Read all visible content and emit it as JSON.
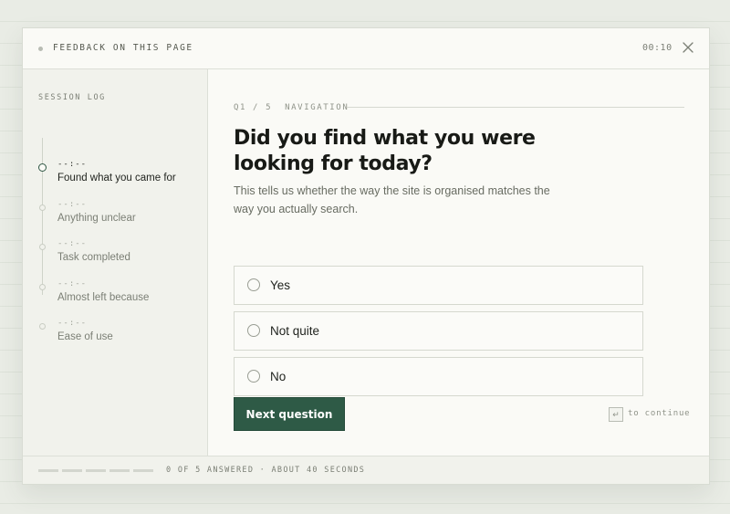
{
  "header": {
    "title": "FEEDBACK ON THIS PAGE",
    "timer": "00:10",
    "close_icon": "close-icon"
  },
  "sidebar": {
    "title": "SESSION LOG",
    "items": [
      {
        "time": "--:--",
        "label": "Found what you came for",
        "active": true
      },
      {
        "time": "--:--",
        "label": "Anything unclear",
        "active": false
      },
      {
        "time": "--:--",
        "label": "Task completed",
        "active": false
      },
      {
        "time": "--:--",
        "label": "Almost left because",
        "active": false
      },
      {
        "time": "--:--",
        "label": "Ease of use",
        "active": false
      }
    ]
  },
  "question": {
    "meta": "Q1 / 5  NAVIGATION",
    "title": "Did you find what you were looking for today?",
    "description": "This tells us whether the way the site is organised matches the way you actually search.",
    "options": [
      {
        "label": "Yes",
        "selected": false
      },
      {
        "label": "Not quite",
        "selected": false
      },
      {
        "label": "No",
        "selected": false
      }
    ],
    "next_label": "Next question",
    "hint_key": "↵",
    "hint_text": "to continue"
  },
  "footer": {
    "progress": {
      "answered": 0,
      "total": 5
    },
    "status": "0 OF 5 ANSWERED · ABOUT 40 SECONDS"
  },
  "colors": {
    "accent": "#2e5a46",
    "background": "#e9ece5",
    "card": "#fafaf6"
  }
}
